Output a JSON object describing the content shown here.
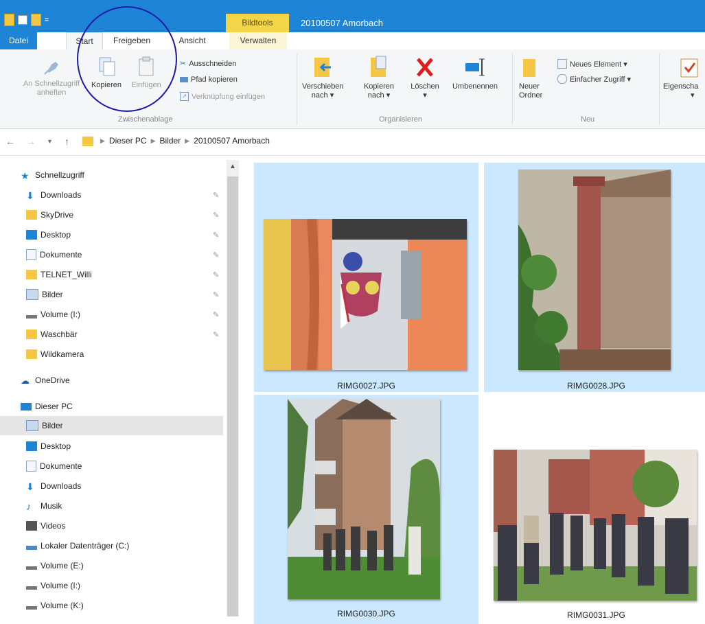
{
  "window": {
    "title": "20100507 Amorbach",
    "context_tab": "Bildtools"
  },
  "tabs": [
    "Datei",
    "Start",
    "Freigeben",
    "Ansicht",
    "Verwalten"
  ],
  "ribbon": {
    "pin_label": "An Schnellzugriff anheften",
    "copy_label": "Kopieren",
    "paste_label": "Einfügen",
    "cut_label": "Ausschneiden",
    "copy_path_label": "Pfad kopieren",
    "paste_shortcut_label": "Verknüpfung einfügen",
    "clipboard_group": "Zwischenablage",
    "move_to_label": "Verschieben nach ▾",
    "copy_to_label": "Kopieren nach ▾",
    "delete_label": "Löschen",
    "delete_arrow": "▾",
    "rename_label": "Umbenennen",
    "organize_group": "Organisieren",
    "new_folder_label": "Neuer Ordner",
    "new_item_label": "Neues Element ▾",
    "easy_access_label": "Einfacher Zugriff ▾",
    "new_group": "Neu",
    "properties_label": "Eigenscha",
    "properties_arrow": "▾"
  },
  "address": {
    "crumbs": [
      "Dieser PC",
      "Bilder",
      "20100507 Amorbach"
    ]
  },
  "navpane": {
    "quick_access": "Schnellzugriff",
    "quick_items": [
      "Downloads",
      "SkyDrive",
      "Desktop",
      "Dokumente",
      "TELNET_Willi",
      "Bilder",
      "Volume (I:)",
      "Waschbär",
      "Wildkamera"
    ],
    "onedrive": "OneDrive",
    "this_pc": "Dieser PC",
    "pc_items": [
      "Bilder",
      "Desktop",
      "Dokumente",
      "Downloads",
      "Musik",
      "Videos",
      "Lokaler Datenträger (C:)",
      "Volume (E:)",
      "Volume (I:)",
      "Volume (K:)"
    ]
  },
  "files": [
    {
      "name": "RIMG0027.JPG",
      "selected": true
    },
    {
      "name": "RIMG0028.JPG",
      "selected": true
    },
    {
      "name": "RIMG0030.JPG",
      "selected": true
    },
    {
      "name": "RIMG0031.JPG",
      "selected": false
    }
  ],
  "colors": {
    "accent": "#1e84d6",
    "selection": "#cce8ff",
    "bildtools": "#f4d547"
  }
}
